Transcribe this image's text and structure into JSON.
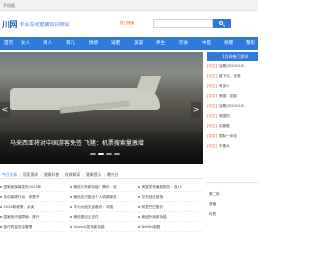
{
  "topbar": {
    "welcome": "手机版"
  },
  "header": {
    "logo_mark": "川网",
    "logo_text": "专业在线健康知识网站",
    "search_tabs": [
      "热门搜索",
      "SEO",
      "360",
      "搜狗",
      "谷歌"
    ],
    "search_placeholder": ""
  },
  "nav": {
    "items": [
      "首页",
      "女人",
      "男人",
      "育儿",
      "情感",
      "减肥",
      "美容",
      "养生",
      "饮食",
      "中医",
      "保健",
      "整形"
    ]
  },
  "slider": {
    "caption": "马来西亚将对中国游客免签 飞猪：机票搜索量激增",
    "prev_label": "<",
    "next_label": ">",
    "dots": [
      "1",
      "2",
      "3",
      "4"
    ],
    "active_dot": 1
  },
  "hot_panel": {
    "title": "1月份热门资讯",
    "rows": [
      {
        "cat": "[中文]",
        "text": "谷歌(GOOGLE)"
      },
      {
        "cat": "[中文]",
        "text": "链下点，优惠"
      },
      {
        "cat": "[中文]",
        "text": "有多少"
      },
      {
        "cat": "[中文]",
        "text": "美国：定制"
      },
      {
        "cat": "[中文]",
        "text": "谷歌(GOOGLE)"
      },
      {
        "cat": "[中文]",
        "text": "美国的"
      },
      {
        "cat": "[中文]",
        "text": "买跑鞋"
      },
      {
        "cat": "[中文]",
        "text": "国际一体化"
      },
      {
        "cat": "[中文]",
        "text": "平衡大"
      }
    ]
  },
  "section_tabs": [
    "今日头条",
    "国家要闻",
    "健康科普",
    "权威解读",
    "健康提示",
    "曝光台"
  ],
  "side_box": {
    "lines": [
      "第二批",
      "资格",
      "标签"
    ]
  },
  "news": {
    "col1": [
      "国家医保局发布2023年",
      "双创保健行动，你是不",
      "2024新政策，买卖",
      "国家医疗保障局：推行",
      "医疗质量安全管理"
    ],
    "col2": [
      "微信又有新功能！腾讯：该",
      "微信支付推出个人收款服务",
      "华为大姐夫孟晚舟：中国",
      "微信推出云支付",
      "OpenAI发布新功能"
    ],
    "col3": [
      "淘宝发布最新报告：双11",
      "京东回应被指",
      "阿里巴巴股价",
      "美团外卖新功能",
      "Netflix新剧"
    ]
  }
}
